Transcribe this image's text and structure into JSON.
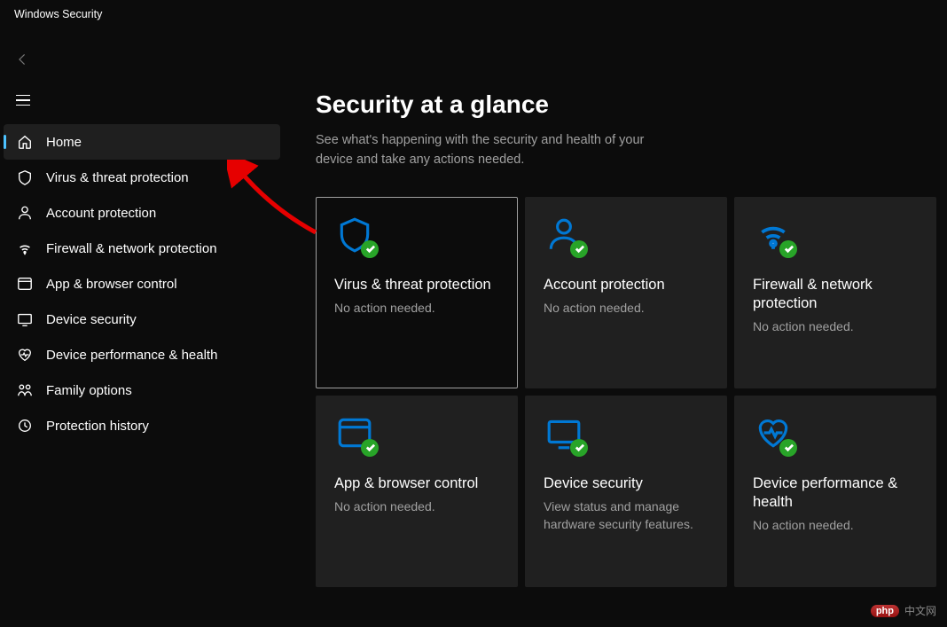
{
  "window": {
    "title": "Windows Security"
  },
  "main": {
    "heading": "Security at a glance",
    "subheading": "See what's happening with the security and health of your device and take any actions needed."
  },
  "sidebar": {
    "items": [
      {
        "label": "Home",
        "icon": "home",
        "selected": true
      },
      {
        "label": "Virus & threat protection",
        "icon": "shield"
      },
      {
        "label": "Account protection",
        "icon": "person"
      },
      {
        "label": "Firewall & network protection",
        "icon": "wifi"
      },
      {
        "label": "App & browser control",
        "icon": "browser"
      },
      {
        "label": "Device security",
        "icon": "device"
      },
      {
        "label": "Device performance & health",
        "icon": "heart"
      },
      {
        "label": "Family options",
        "icon": "family"
      },
      {
        "label": "Protection history",
        "icon": "history"
      }
    ]
  },
  "cards": [
    {
      "title": "Virus & threat protection",
      "status": "No action needed.",
      "icon": "shield",
      "badge": true,
      "selected": true
    },
    {
      "title": "Account protection",
      "status": "No action needed.",
      "icon": "person",
      "badge": true
    },
    {
      "title": "Firewall & network protection",
      "status": "No action needed.",
      "icon": "wifi",
      "badge": true
    },
    {
      "title": "App & browser control",
      "status": "No action needed.",
      "icon": "browser",
      "badge": true
    },
    {
      "title": "Device security",
      "status": "View status and manage hardware security features.",
      "icon": "device",
      "badge": true
    },
    {
      "title": "Device performance & health",
      "status": "No action needed.",
      "icon": "heart",
      "badge": true
    }
  ],
  "watermark": {
    "pill": "php",
    "text": "中文网"
  }
}
